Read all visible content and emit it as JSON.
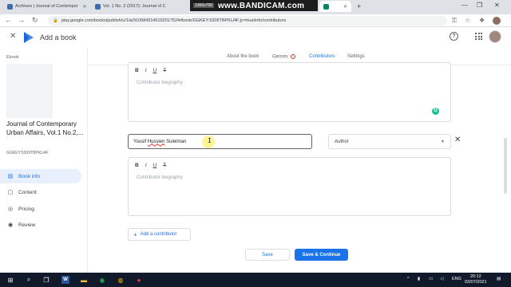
{
  "browser": {
    "tabs": [
      {
        "title": "Archives | Journal of Contempor",
        "favicon_color": "#3c6db0"
      },
      {
        "title": "Vol. 1 No. 2 (2017): Journal of C",
        "favicon_color": "#3c6db0"
      }
    ],
    "bandicam": {
      "resolution": "1366x768",
      "brand": "www.BANDICAM.com"
    },
    "url": "play.google.com/books/publish/u/1/a/9109843145162017524#book/GGKEY:5309TBPKU4F;jc=true/info/contributors"
  },
  "app": {
    "title": "Add a book",
    "colors": {
      "accent": "#1a73e8",
      "error": "#d93025"
    }
  },
  "sidebar": {
    "ebook_label": "Ebook",
    "book_title": "Journal of Contemporary Urban Affairs, Vol.1 No.2,...",
    "gg_key": "GGKEY:5309TBPKU4F",
    "nav": [
      {
        "label": "Book info",
        "icon": "info-icon",
        "active": true
      },
      {
        "label": "Content",
        "icon": "file-icon",
        "active": false
      },
      {
        "label": "Pricing",
        "icon": "pricing-icon",
        "active": false
      },
      {
        "label": "Review",
        "icon": "review-icon",
        "active": false
      }
    ]
  },
  "page_tabs": {
    "about": "About the book",
    "genres": "Genres",
    "contributors": "Contributors",
    "settings": "Settings",
    "active": "Contributors"
  },
  "editor": {
    "bold": "B",
    "italic": "I",
    "underline": "U",
    "clear": "T",
    "bio_placeholder": "Contributor biography"
  },
  "contributor": {
    "name_first": "Yousif",
    "name_middle": "Hussien",
    "name_last": "Suleiman",
    "role": "Author"
  },
  "actions": {
    "add_contributor": "Add a contributor",
    "save": "Save",
    "save_continue": "Save & Continue"
  },
  "taskbar": {
    "lang": "ENG",
    "time": "20:12",
    "date": "03/07/2021"
  }
}
